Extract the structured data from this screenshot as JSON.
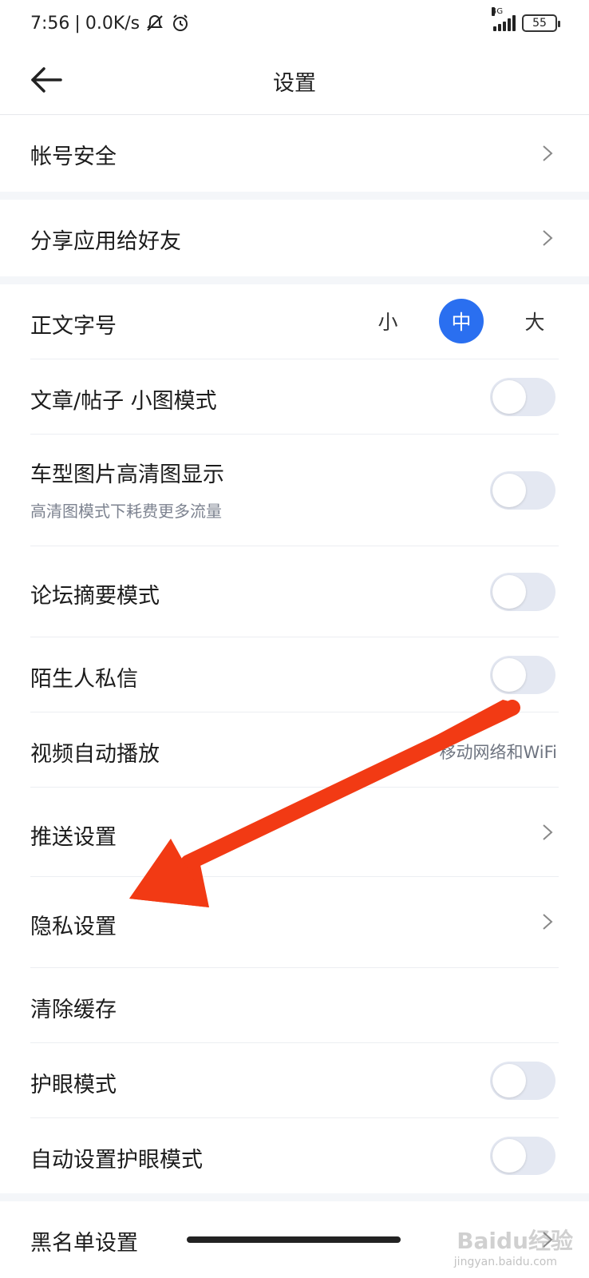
{
  "status": {
    "time": "7:56",
    "speed": "0.0K/s",
    "network": "4G",
    "battery": "55"
  },
  "header": {
    "title": "设置"
  },
  "rows": {
    "account": {
      "label": "帐号安全"
    },
    "share": {
      "label": "分享应用给好友"
    },
    "font_size": {
      "label": "正文字号",
      "options": [
        "小",
        "中",
        "大"
      ],
      "selected": "中"
    },
    "small_image": {
      "label": "文章/帖子 小图模式",
      "on": false
    },
    "hd_image": {
      "label": "车型图片高清图显示",
      "sub": "高清图模式下耗费更多流量",
      "on": false
    },
    "forum_summary": {
      "label": "论坛摘要模式",
      "on": false
    },
    "stranger_msg": {
      "label": "陌生人私信",
      "on": false
    },
    "video_autoplay": {
      "label": "视频自动播放",
      "value": "移动网络和WiFi"
    },
    "push": {
      "label": "推送设置"
    },
    "privacy": {
      "label": "隐私设置"
    },
    "clear_cache": {
      "label": "清除缓存"
    },
    "eye_mode": {
      "label": "护眼模式",
      "on": false
    },
    "auto_eye_mode": {
      "label": "自动设置护眼模式",
      "on": false
    },
    "blacklist": {
      "label": "黑名单设置"
    }
  },
  "watermark": {
    "brand": "Baidu经验",
    "url": "jingyan.baidu.com"
  },
  "colors": {
    "accent": "#2a6ff0",
    "arrow": "#f23a14",
    "toggle_off": "#e4e8f2"
  }
}
